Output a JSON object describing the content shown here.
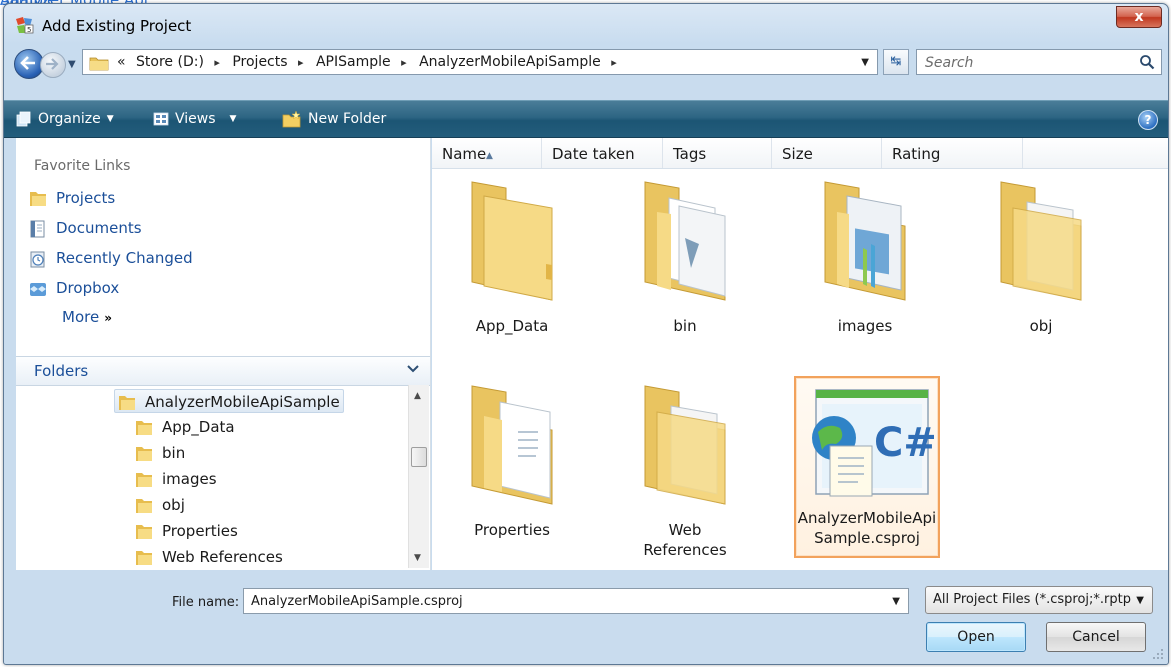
{
  "window": {
    "title": "Add Existing Project",
    "close_glyph": "x"
  },
  "stray_text": "Analyzer Mobile Api Sample",
  "address_bar": {
    "breadcrumbs": [
      "«",
      "Store (D:)",
      "Projects",
      "APISample",
      "AnalyzerMobileApiSample"
    ],
    "separator_glyph": "▸"
  },
  "search": {
    "placeholder": "Search"
  },
  "toolbar": {
    "organize_label": "Organize",
    "views_label": "Views",
    "new_folder_label": "New Folder",
    "help_glyph": "?"
  },
  "favorites": {
    "header": "Favorite Links",
    "items": [
      {
        "label": "Projects",
        "icon": "folder-icon"
      },
      {
        "label": "Documents",
        "icon": "documents-icon"
      },
      {
        "label": "Recently Changed",
        "icon": "recent-icon"
      },
      {
        "label": "Dropbox",
        "icon": "dropbox-icon"
      }
    ],
    "more_label": "More",
    "more_glyph": "»"
  },
  "folders": {
    "header": "Folders",
    "tree": [
      {
        "label": "AnalyzerMobileApiSample",
        "selected": true
      },
      {
        "label": "App_Data"
      },
      {
        "label": "bin"
      },
      {
        "label": "images"
      },
      {
        "label": "obj"
      },
      {
        "label": "Properties"
      },
      {
        "label": "Web References"
      }
    ]
  },
  "columns": [
    "Name",
    "Date taken",
    "Tags",
    "Size",
    "Rating"
  ],
  "files": [
    {
      "label": "App_Data",
      "kind": "folder"
    },
    {
      "label": "bin",
      "kind": "folder"
    },
    {
      "label": "images",
      "kind": "folder"
    },
    {
      "label": "obj",
      "kind": "folder"
    },
    {
      "label": "Properties",
      "kind": "folder"
    },
    {
      "label": "Web References",
      "kind": "folder"
    },
    {
      "label_line1": "AnalyzerMobileApi",
      "label_line2": "Sample.csproj",
      "kind": "csproj",
      "selected": true
    }
  ],
  "csproj_badge": "C#",
  "file_name": {
    "label": "File name:",
    "value": "AnalyzerMobileApiSample.csproj"
  },
  "filter": {
    "value": "All Project Files (*.csproj;*.rptp"
  },
  "buttons": {
    "open": "Open",
    "cancel": "Cancel"
  },
  "colors": {
    "accent": "#1b4f99",
    "toolbar": "#235d7c",
    "selection_border": "#f2a25c",
    "title_band": "#c8dcef"
  }
}
